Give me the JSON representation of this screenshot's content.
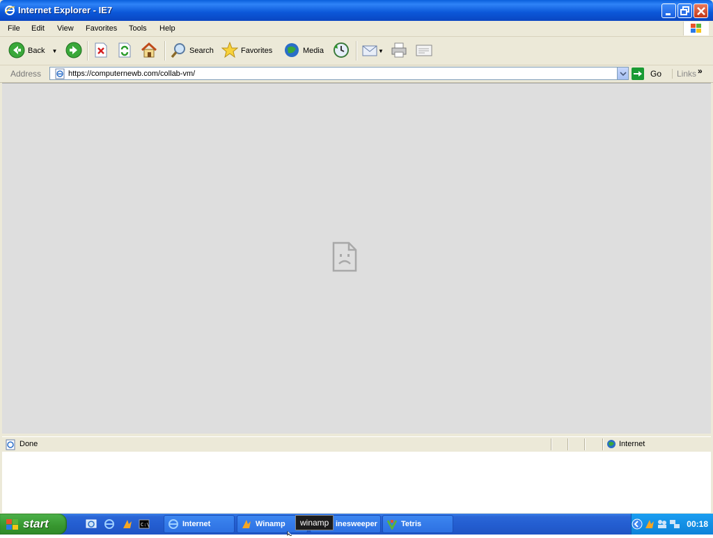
{
  "window": {
    "title": "Internet Explorer - IE7"
  },
  "menu": {
    "items": [
      "File",
      "Edit",
      "View",
      "Favorites",
      "Tools",
      "Help"
    ]
  },
  "toolbar": {
    "back_label": "Back",
    "search_label": "Search",
    "favorites_label": "Favorites",
    "media_label": "Media"
  },
  "address": {
    "label": "Address",
    "url": "https://computernewb.com/collab-vm/",
    "go_label": "Go",
    "links_label": "Links",
    "links_chevron": "»"
  },
  "status": {
    "text": "Done",
    "zone": "Internet"
  },
  "taskbar": {
    "start_label": "start",
    "tasks": [
      {
        "label": "Internet",
        "icon": "ie-icon"
      },
      {
        "label": "Winamp",
        "icon": "winamp-icon"
      },
      {
        "label": "inesweeper",
        "icon": "minesweeper-icon"
      },
      {
        "label": "Tetris",
        "icon": "tetris-icon"
      }
    ],
    "tooltip": "winamp",
    "clock": "00:18"
  },
  "colors": {
    "titlebar": "#0a5fdc",
    "taskbar": "#245ed1",
    "start": "#37962f",
    "content_bg": "#dedede"
  }
}
